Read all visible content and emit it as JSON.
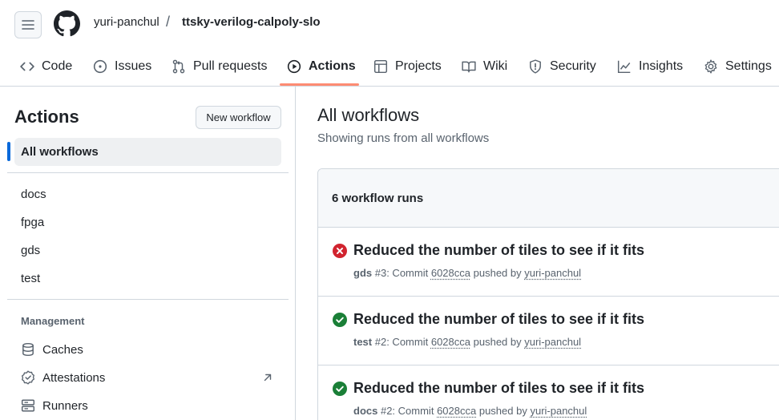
{
  "header": {
    "owner": "yuri-panchul",
    "separator": "/",
    "repo": "ttsky-verilog-calpoly-slo"
  },
  "nav": {
    "code": "Code",
    "issues": "Issues",
    "pull_requests": "Pull requests",
    "actions": "Actions",
    "projects": "Projects",
    "wiki": "Wiki",
    "security": "Security",
    "insights": "Insights",
    "settings": "Settings"
  },
  "sidebar": {
    "title": "Actions",
    "new_workflow": "New workflow",
    "all_workflows": "All workflows",
    "workflows": [
      "docs",
      "fpga",
      "gds",
      "test"
    ],
    "management_heading": "Management",
    "management": [
      "Caches",
      "Attestations",
      "Runners"
    ]
  },
  "main": {
    "title": "All workflows",
    "subtitle": "Showing runs from all workflows",
    "runs_count": "6 workflow runs",
    "runs": [
      {
        "status": "failure",
        "title": "Reduced the number of tiles to see if it fits",
        "workflow": "gds",
        "run": "#3: Commit",
        "commit": "6028cca",
        "pushed_by": "pushed by",
        "user": "yuri-panchul"
      },
      {
        "status": "success",
        "title": "Reduced the number of tiles to see if it fits",
        "workflow": "test",
        "run": "#2: Commit",
        "commit": "6028cca",
        "pushed_by": "pushed by",
        "user": "yuri-panchul"
      },
      {
        "status": "success",
        "title": "Reduced the number of tiles to see if it fits",
        "workflow": "docs",
        "run": "#2: Commit",
        "commit": "6028cca",
        "pushed_by": "pushed by",
        "user": "yuri-panchul"
      }
    ]
  },
  "colors": {
    "accent_underline": "#fd8c73",
    "success": "#1a7f37",
    "failure": "#d1242f",
    "link_blue": "#0969da"
  }
}
